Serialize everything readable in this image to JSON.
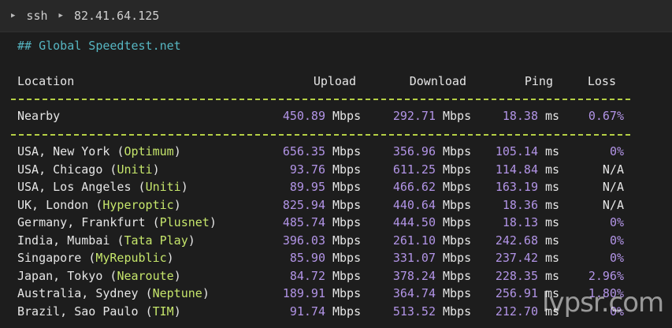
{
  "breadcrumb": {
    "items": [
      "ssh",
      "82.41.64.125"
    ]
  },
  "heading": "## Global Speedtest.net",
  "columns": {
    "location": "Location",
    "upload": "Upload",
    "download": "Download",
    "ping": "Ping",
    "loss": "Loss"
  },
  "units": {
    "speed": "Mbps",
    "latency": "ms"
  },
  "nearby": {
    "location": "Nearby",
    "upload": "450.89",
    "download": "292.71",
    "ping": "18.38",
    "loss": "0.67%"
  },
  "rows": [
    {
      "city": "USA, New York ",
      "isp": "Optimum",
      "upload": "656.35",
      "download": "356.96",
      "ping": "105.14",
      "loss": "0%"
    },
    {
      "city": "USA, Chicago ",
      "isp": "Uniti",
      "upload": "93.76",
      "download": "611.25",
      "ping": "114.84",
      "loss": "N/A"
    },
    {
      "city": "USA, Los Angeles ",
      "isp": "Uniti",
      "upload": "89.95",
      "download": "466.62",
      "ping": "163.19",
      "loss": "N/A"
    },
    {
      "city": "UK, London ",
      "isp": "Hyperoptic",
      "upload": "825.94",
      "download": "440.64",
      "ping": "18.36",
      "loss": "N/A"
    },
    {
      "city": "Germany, Frankfurt ",
      "isp": "Plusnet",
      "upload": "485.74",
      "download": "444.50",
      "ping": "18.13",
      "loss": "0%"
    },
    {
      "city": "India, Mumbai ",
      "isp": "Tata Play",
      "upload": "396.03",
      "download": "261.10",
      "ping": "242.68",
      "loss": "0%"
    },
    {
      "city": "Singapore ",
      "isp": "MyRepublic",
      "upload": "85.90",
      "download": "331.07",
      "ping": "237.42",
      "loss": "0%"
    },
    {
      "city": "Japan, Tokyo ",
      "isp": "Nearoute",
      "upload": "84.72",
      "download": "378.24",
      "ping": "228.35",
      "loss": "2.96%"
    },
    {
      "city": "Australia, Sydney ",
      "isp": "Neptune",
      "upload": "189.91",
      "download": "364.74",
      "ping": "256.91",
      "loss": "1.80%"
    },
    {
      "city": "Brazil, Sao Paulo ",
      "isp": "TIM",
      "upload": "91.74",
      "download": "513.52",
      "ping": "212.70",
      "loss": "0%"
    }
  ],
  "watermark": "lvpsr.com",
  "colors": {
    "value": "#b294e6",
    "isp": "#c6e66b",
    "heading": "#56b6c2",
    "separator": "#b5cf45",
    "background": "#1d1d1d"
  }
}
